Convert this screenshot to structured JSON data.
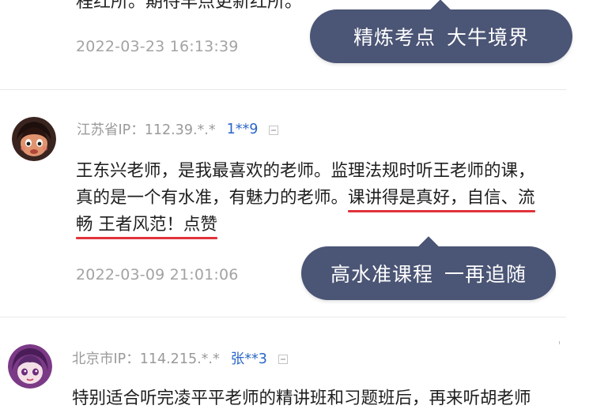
{
  "top_comment": {
    "cut_text": "程红所。期待早点更新红所。",
    "timestamp": "2022-03-23 16:13:39",
    "bubble": {
      "part1": "精炼考点",
      "part2": "大牛境界"
    }
  },
  "comments": [
    {
      "location": "江苏省IP：112.39.*.*",
      "user": "1**9",
      "lines": [
        "王东兴老师，是我最喜欢的老师。监理法规时听王老师的课，",
        "真的是一个有水准，有魅力的老师。",
        "课讲得是真好，自信、流",
        "畅 王者风范！点赞"
      ],
      "timestamp": "2022-03-09 21:01:06",
      "bubble": {
        "part1": "高水准课程",
        "part2": "一再追随"
      }
    },
    {
      "location": "北京市IP：114.215.*.*",
      "user": "张**3",
      "lines": [
        "特别适合听完凌平平老师的精讲班和习题班后，再来听胡老师"
      ]
    }
  ],
  "colors": {
    "bubble": "#4b5575",
    "highlight_underline": "#e0333b",
    "username": "#2a66c8",
    "meta": "#9a9a9a",
    "timestamp": "#a3a3a3"
  }
}
